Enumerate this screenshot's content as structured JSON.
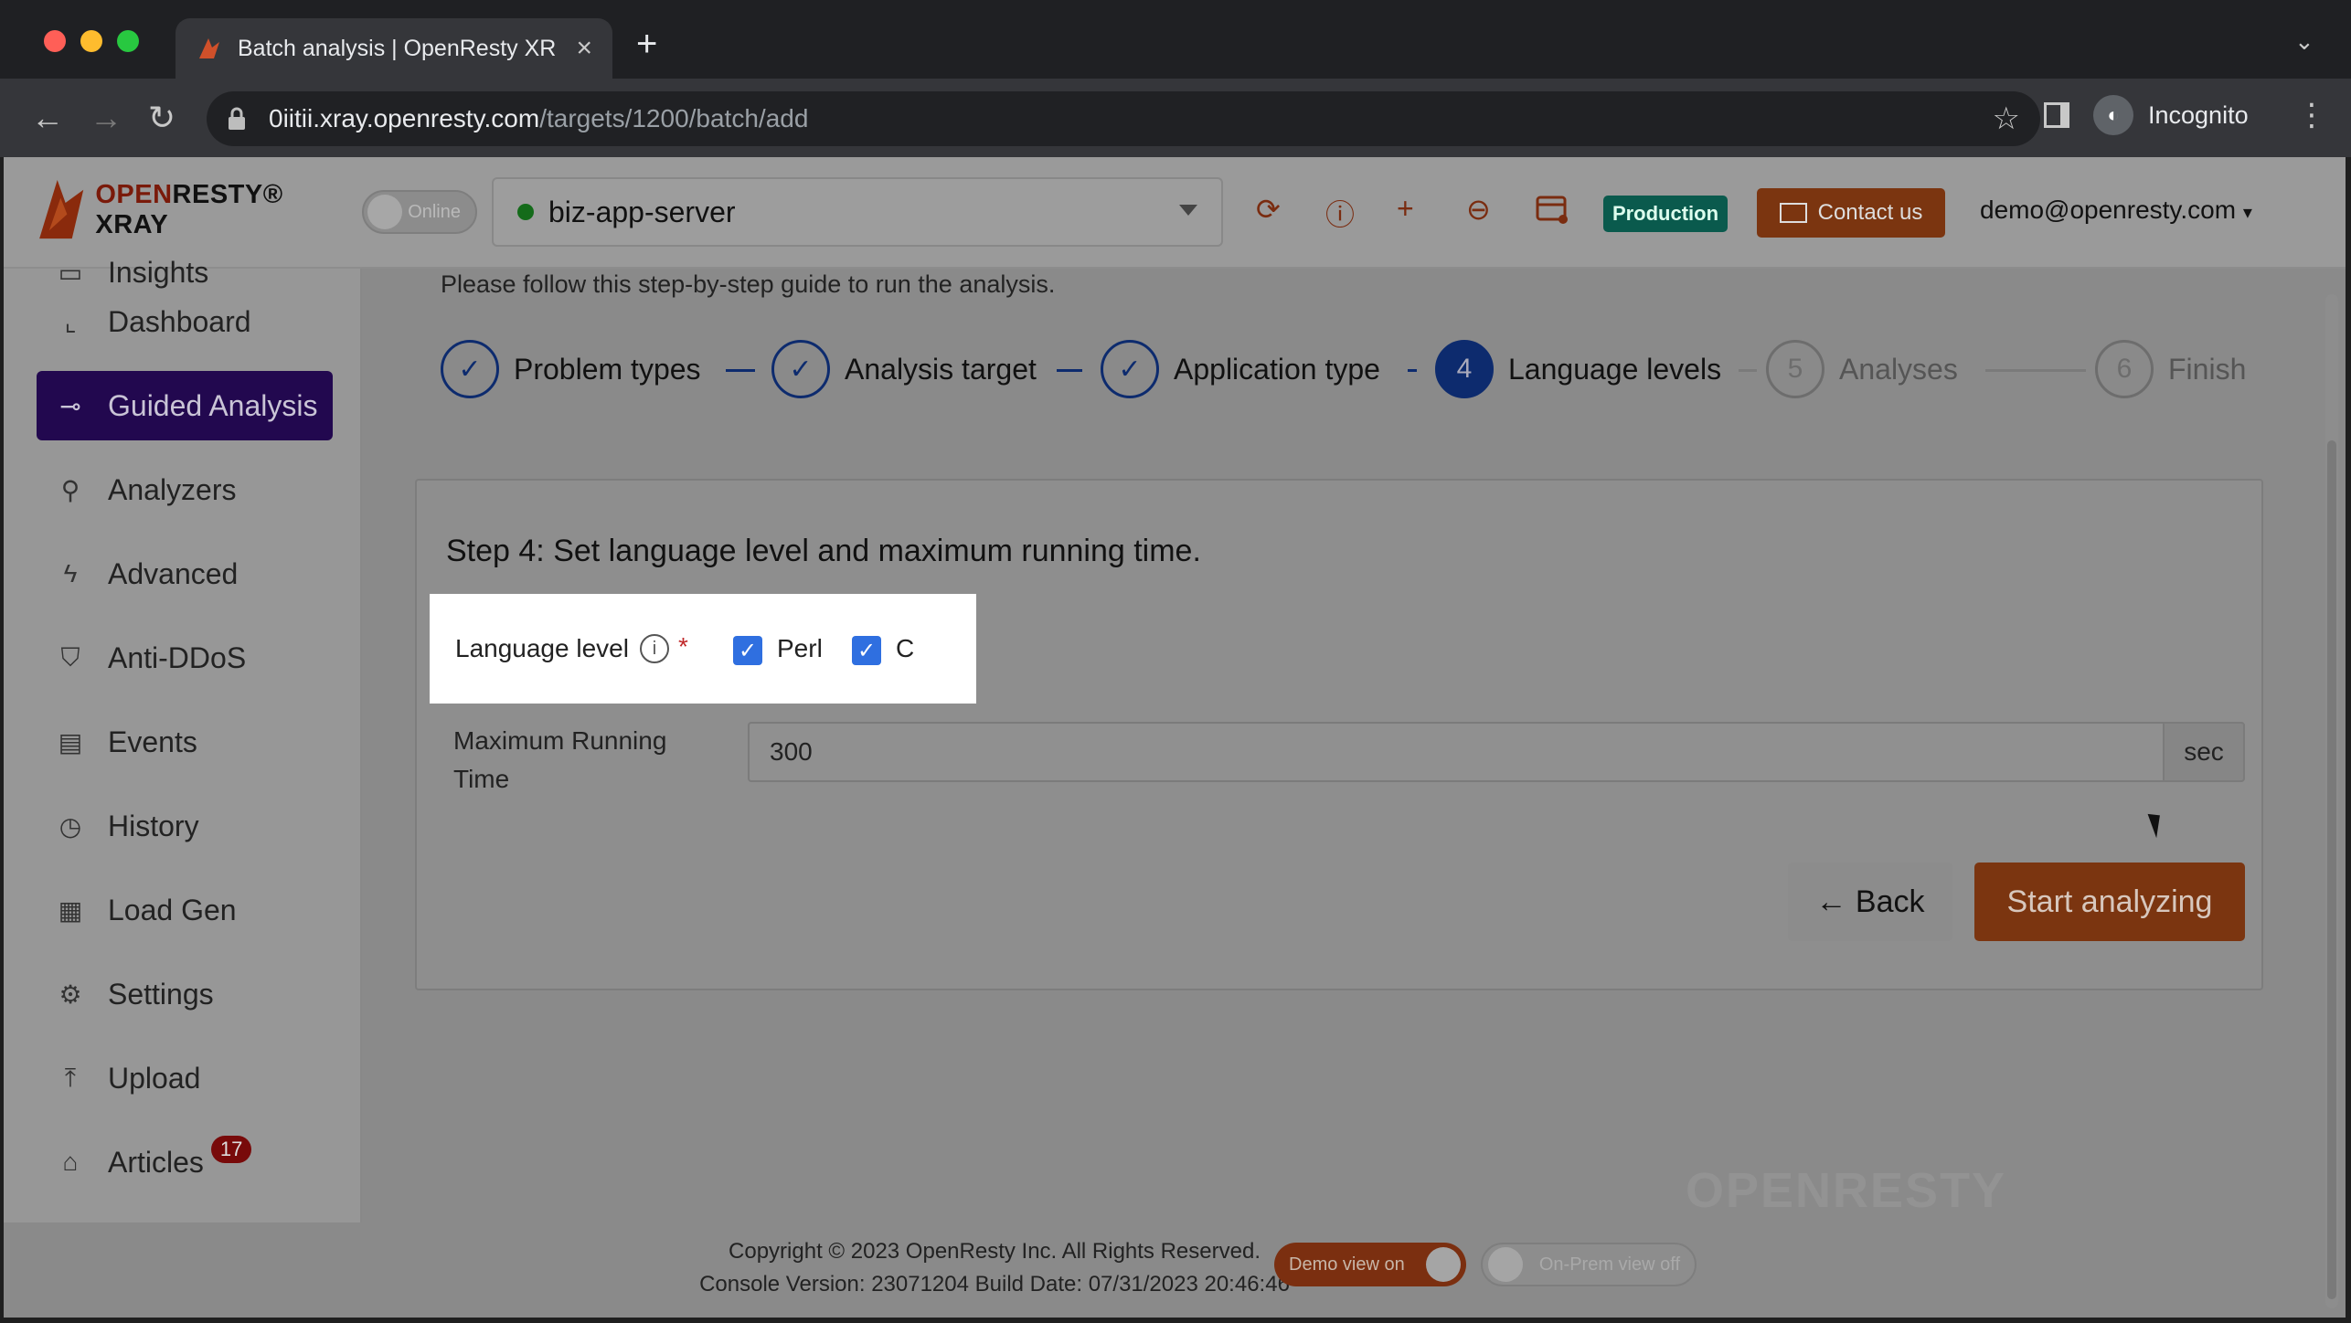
{
  "browser": {
    "tab_title": "Batch analysis | OpenResty XR",
    "url_host": "0iitii.xray.openresty.com",
    "url_path": "/targets/1200/batch/add",
    "profile_label": "Incognito"
  },
  "header": {
    "logo_text_open": "OPEN",
    "logo_text_rest": "RESTY® XRAY",
    "online_label": "Online",
    "app_name": "biz-app-server",
    "env_badge": "Production",
    "contact_label": "Contact us",
    "user_email": "demo@openresty.com"
  },
  "sidebar": {
    "items": [
      {
        "label": "Insights",
        "icon": "lightbulb-icon"
      },
      {
        "label": "Dashboard",
        "icon": "chart-icon"
      },
      {
        "label": "Guided Analysis",
        "icon": "guided-icon"
      },
      {
        "label": "Analyzers",
        "icon": "analyzer-icon"
      },
      {
        "label": "Advanced",
        "icon": "bolt-icon"
      },
      {
        "label": "Anti-DDoS",
        "icon": "shield-icon"
      },
      {
        "label": "Events",
        "icon": "calendar-icon"
      },
      {
        "label": "History",
        "icon": "clock-icon"
      },
      {
        "label": "Load Gen",
        "icon": "loadgen-icon"
      },
      {
        "label": "Settings",
        "icon": "gear-icon"
      },
      {
        "label": "Upload",
        "icon": "upload-icon"
      },
      {
        "label": "Articles",
        "icon": "articles-icon",
        "badge": "17"
      }
    ]
  },
  "main": {
    "guide_text": "Please follow this step-by-step guide to run the analysis.",
    "steps": [
      {
        "num": "1",
        "label": "Problem types",
        "state": "done"
      },
      {
        "num": "2",
        "label": "Analysis target",
        "state": "done"
      },
      {
        "num": "3",
        "label": "Application type",
        "state": "done"
      },
      {
        "num": "4",
        "label": "Language levels",
        "state": "current"
      },
      {
        "num": "5",
        "label": "Analyses",
        "state": "pending"
      },
      {
        "num": "6",
        "label": "Finish",
        "state": "pending"
      }
    ],
    "step_title": "Step 4: Set language level and maximum running time.",
    "language_level_label": "Language level",
    "required_mark": "*",
    "languages": [
      {
        "label": "Perl",
        "checked": true
      },
      {
        "label": "C",
        "checked": true
      }
    ],
    "max_running_time_label": "Maximum Running Time",
    "max_running_time_value": "300",
    "max_running_time_unit": "sec",
    "back_label": "← Back",
    "start_label": "Start analyzing"
  },
  "footer": {
    "copyright": "Copyright © 2023 OpenResty Inc. All Rights Reserved.",
    "version": "Console Version: 23071204 Build Date: 07/31/2023 20:46:46",
    "demo_view": "Demo view on",
    "onprem_view": "On-Prem view off",
    "watermark": "OPENRESTY"
  },
  "colors": {
    "accent_primary": "#22084f",
    "accent_orange": "#7b3510",
    "checkbox_blue": "#2f6fe0",
    "production_badge": "#0a5a4d"
  }
}
